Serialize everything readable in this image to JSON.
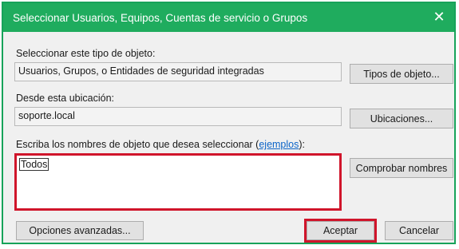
{
  "window": {
    "title": "Seleccionar Usuarios, Equipos, Cuentas de servicio o Grupos",
    "close_glyph": "✕"
  },
  "object_type": {
    "label": "Seleccionar este tipo de objeto:",
    "value": "Usuarios, Grupos, o Entidades de seguridad integradas",
    "button": "Tipos de objeto..."
  },
  "location": {
    "label": "Desde esta ubicación:",
    "value": "soporte.local",
    "button": "Ubicaciones..."
  },
  "names": {
    "label_prefix": "Escriba los nombres de objeto que desea seleccionar (",
    "label_link": "ejemplos",
    "label_suffix": "):",
    "value": "Todos",
    "check_button": "Comprobar nombres"
  },
  "footer": {
    "advanced_button": "Opciones avanzadas...",
    "ok_button": "Aceptar",
    "cancel_button": "Cancelar"
  },
  "colors": {
    "titlebar": "#1fac5e",
    "highlight": "#d0152b",
    "link": "#0b64c8"
  }
}
